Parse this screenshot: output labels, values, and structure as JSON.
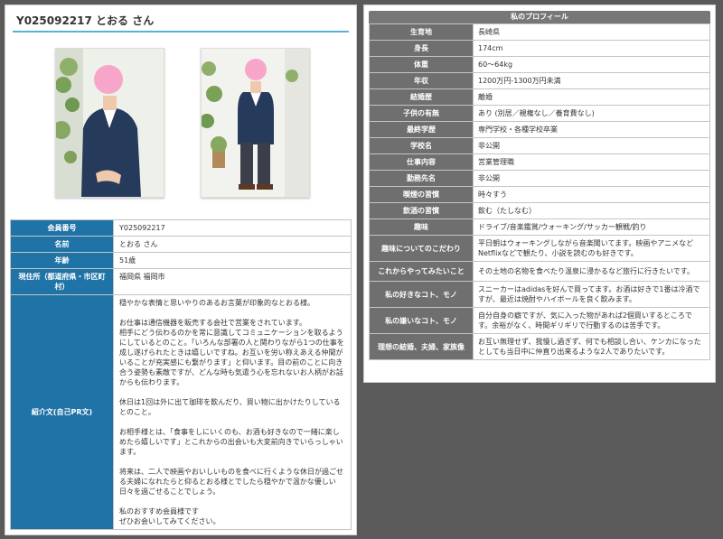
{
  "header": {
    "title": "Y025092217 とおる さん"
  },
  "member": {
    "rows": [
      {
        "key": "会員番号",
        "value": "Y025092217"
      },
      {
        "key": "名前",
        "value": "とおる さん"
      },
      {
        "key": "年齢",
        "value": "51歳"
      },
      {
        "key": "現住所（都道府県・市区町村）",
        "value": "福岡県 福岡市"
      }
    ],
    "intro_label": "紹介文(自己PR文)",
    "intro": [
      "穏やかな表情と思いやりのあるお言葉が印象的なとおる様。",
      "お仕事は通信機器を販売する会社で営業をされています。\n相手にどう伝わるのかを常に意識してコミュニケーションを取るようにしているとのこと。「いろんな部署の人と関わりながら1つの仕事を成し遂げられたときは嬉しいですね。お互いを労い称えあえる仲間がいることが充実感にも繋がります」と仰います。目の前のことに向き合う姿勢も素敵ですが、どんな時も気遣う心を忘れないお人柄がお話からも伝わります。",
      "休日は1回は外に出て珈琲を飲んだり、買い物に出かけたりしているとのこと。",
      "お相手様とは、「食事をしにいくのも、お酒も好きなので一緒に楽しめたら嬉しいです」とこれからの出会いも大変前向きでいらっしゃいます。",
      "将来は、二人で映画やおいしいものを食べに行くような休日が過ごせる夫婦になれたらと仰るとおる様とでしたら穏やかで温かな優しい日々を過ごせることでしょう。",
      "私のおすすめ会員様です\nぜひお会いしてみてください。"
    ]
  },
  "profile": {
    "title": "私のプロフィール",
    "rows": [
      {
        "key": "生育地",
        "value": "長崎県"
      },
      {
        "key": "身長",
        "value": "174cm"
      },
      {
        "key": "体重",
        "value": "60～64kg"
      },
      {
        "key": "年収",
        "value": "1200万円-1300万円未満"
      },
      {
        "key": "結婚歴",
        "value": "離婚"
      },
      {
        "key": "子供の有無",
        "value": "あり (別居／親権なし／養育費なし)"
      },
      {
        "key": "最終学歴",
        "value": "専門学校・各種学校卒業"
      },
      {
        "key": "学校名",
        "value": "非公開"
      },
      {
        "key": "仕事内容",
        "value": "営業管理職"
      },
      {
        "key": "勤務先名",
        "value": "非公開"
      },
      {
        "key": "喫煙の習慣",
        "value": "時々すう"
      },
      {
        "key": "飲酒の習慣",
        "value": "飲む（たしなむ）"
      },
      {
        "key": "趣味",
        "value": "ドライブ/音楽鑑賞/ウォーキング/サッカー観戦/釣り"
      },
      {
        "key": "趣味についてのこだわり",
        "value": "平日朝はウォーキングしながら音楽聞いてます。映画やアニメなどNetflixなどで観たり、小説を読むのも好きです。"
      },
      {
        "key": "これからやってみたいこと",
        "value": "その土地の名物を食べたり温泉に浸かるなど旅行に行きたいです。"
      },
      {
        "key": "私の好きなコト、モノ",
        "value": "スニーカーはadidasを好んで買ってます。お酒は好きで1番は冷酒ですが、最近は焼酎やハイボールを良く飲みます。"
      },
      {
        "key": "私の嫌いなコト、モノ",
        "value": "自分自身の癖ですが、気に入った物があれば2個買いするところです。余裕がなく、時間ギリギリで行動するのは苦手です。"
      },
      {
        "key": "理想の結婚、夫婦、家族像",
        "value": "お互い無理せず、我慢し過ぎず、何でも相談し合い、ケンカになったとしても当日中に仲直り出来るような2人でありたいです。"
      }
    ]
  },
  "colors": {
    "header_accent": "#5ab1d8",
    "member_key_bg": "#1f73a6",
    "profile_key_bg": "#6f6f6f"
  },
  "icons": [
    "face-blur-circle"
  ]
}
